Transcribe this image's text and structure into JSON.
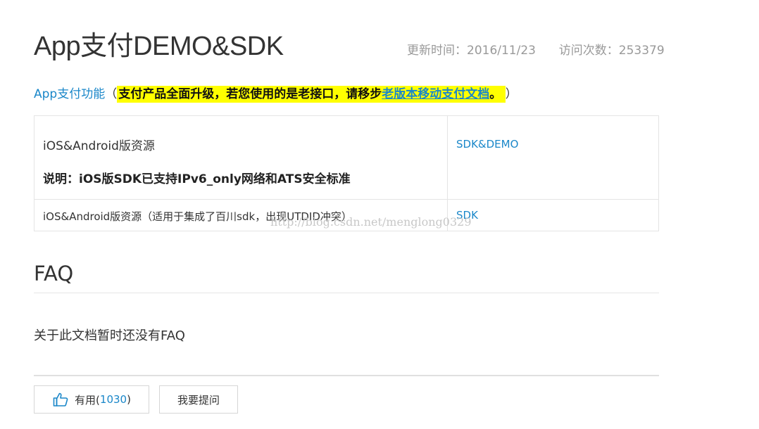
{
  "header": {
    "title": "App支付DEMO&SDK",
    "updated_label": "更新时间：",
    "updated_value": "2016/11/23",
    "visits_label": "访问次数：",
    "visits_value": "253379"
  },
  "intro": {
    "prefix_link": "App支付功能",
    "open_paren": "（",
    "highlight_text": "支付产品全面升级，若您使用的是老接口，请移步",
    "highlight_link": "老版本移动支付文档",
    "highlight_end": "。",
    "close_paren": "）"
  },
  "resources": {
    "rows": [
      {
        "name": "iOS&Android版资源",
        "note": "说明：iOS版SDK已支持IPv6_only网络和ATS安全标准",
        "link": "SDK&DEMO"
      },
      {
        "name": "iOS&Android版资源（适用于集成了百川sdk，出现UTDID冲突）",
        "link": "SDK"
      }
    ]
  },
  "watermark": "http://blog.csdn.net/menglong0329",
  "faq": {
    "title": "FAQ",
    "empty_text": "关于此文档暂时还没有FAQ"
  },
  "feedback": {
    "useful_label": "有用(",
    "useful_count": "1030",
    "useful_close": ")",
    "ask_label": "我要提问"
  },
  "colors": {
    "link": "#1a87c9",
    "highlight": "#ffff00",
    "meta_text": "#999999"
  }
}
